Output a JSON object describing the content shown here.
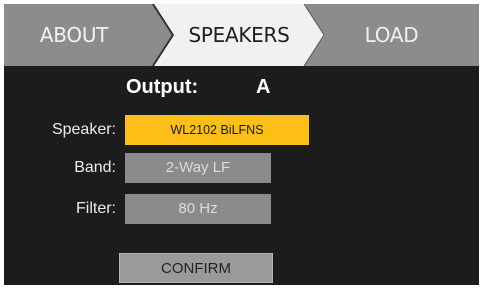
{
  "tabs": [
    {
      "label": "ABOUT",
      "state": "inactive"
    },
    {
      "label": "SPEAKERS",
      "state": "active"
    },
    {
      "label": "LOAD",
      "state": "inactive"
    }
  ],
  "output": {
    "label": "Output:",
    "value": "A"
  },
  "fields": {
    "speaker": {
      "label": "Speaker:",
      "value": "WL2102 BiLFNS"
    },
    "band": {
      "label": "Band:",
      "value": "2-Way LF"
    },
    "filter": {
      "label": "Filter:",
      "value": "80 Hz"
    }
  },
  "confirm_label": "CONFIRM",
  "colors": {
    "background": "#1c1c1c",
    "tab_inactive": "#8c8c8c",
    "tab_active": "#f1f1f1",
    "accent": "#fbbf17",
    "field_disabled": "#8b8b8b"
  }
}
